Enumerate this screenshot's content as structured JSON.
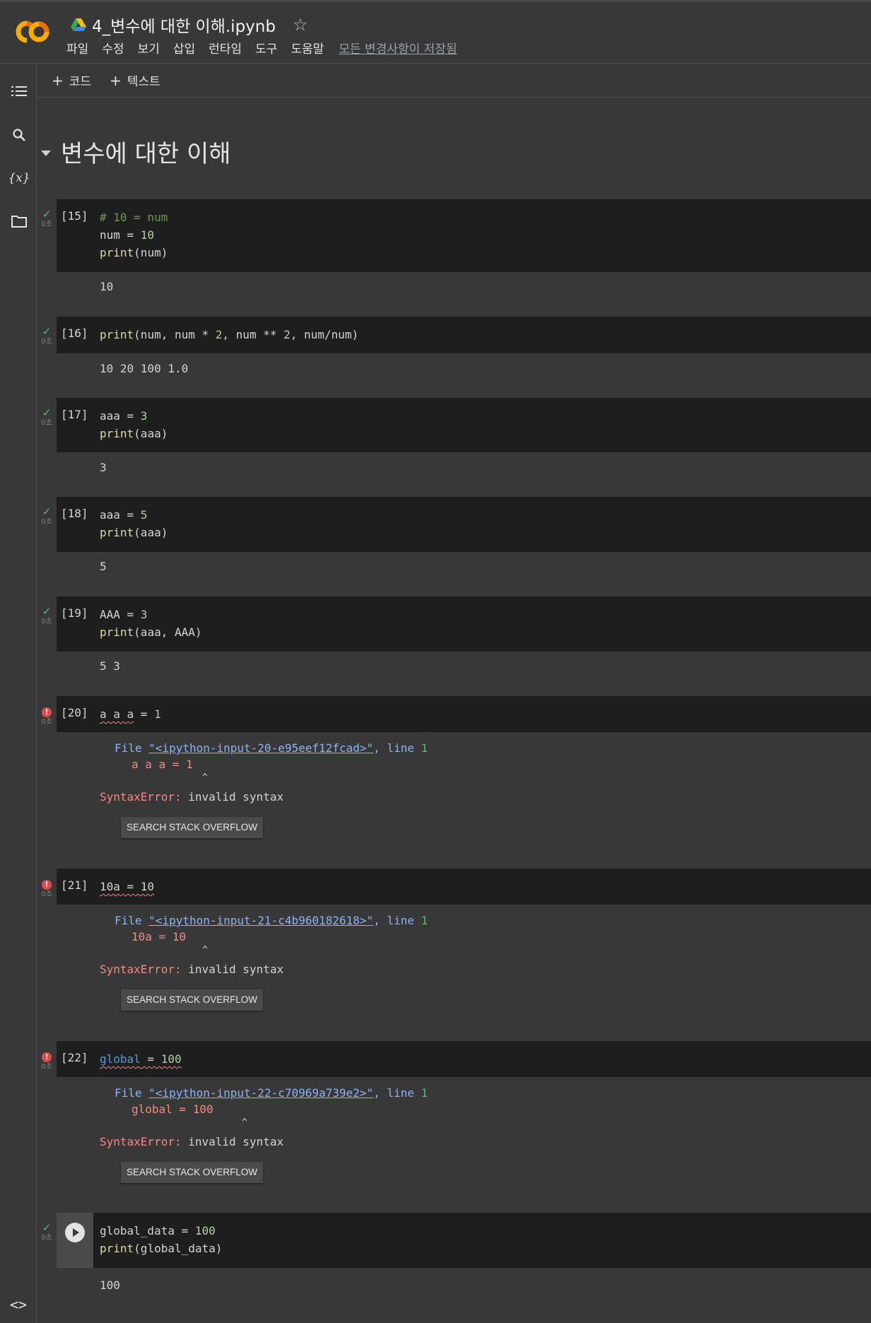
{
  "header": {
    "title": "4_변수에 대한 이해.ipynb",
    "menu": [
      "파일",
      "수정",
      "보기",
      "삽입",
      "런타임",
      "도구",
      "도움말"
    ],
    "save_status": "모든 변경사항이 저장됨"
  },
  "sidebar": {
    "icons": [
      "table-of-contents-icon",
      "search-icon",
      "variables-icon",
      "folder-icon"
    ],
    "variables_label": "{x}",
    "bottom_label": "<>"
  },
  "toolbar": {
    "add_code": "코드",
    "add_text": "텍스트"
  },
  "section": {
    "heading": "변수에 대한 이해"
  },
  "cells": {
    "c15": {
      "exec": "[15]",
      "time": "0초",
      "output": "10"
    },
    "c16": {
      "exec": "[16]",
      "time": "0초",
      "output": "10 20 100 1.0"
    },
    "c17": {
      "exec": "[17]",
      "time": "0초",
      "output": "3"
    },
    "c18": {
      "exec": "[18]",
      "time": "0초",
      "output": "5"
    },
    "c19": {
      "exec": "[19]",
      "time": "0초",
      "output": "5 3"
    },
    "c20": {
      "exec": "[20]",
      "time": "0초",
      "file": "\"<ipython-input-20-e95eef12fcad>\"",
      "err_line": "a a a = 1",
      "error_type": "SyntaxError:",
      "error_msg": " invalid syntax"
    },
    "c21": {
      "exec": "[21]",
      "time": "0초",
      "file": "\"<ipython-input-21-c4b960182618>\"",
      "err_line": "10a = 10",
      "error_type": "SyntaxError:",
      "error_msg": " invalid syntax"
    },
    "c22": {
      "exec": "[22]",
      "time": "0초",
      "file": "\"<ipython-input-22-c70969a739e2>\"",
      "err_line": "global = 100",
      "error_type": "SyntaxError:",
      "error_msg": " invalid syntax"
    },
    "c23": {
      "time": "0초",
      "output": "100"
    }
  },
  "traceback": {
    "file_label": "File ",
    "line_label": ", line ",
    "line_no": "1",
    "caret": "^"
  },
  "so_button": "SEARCH STACK OVERFLOW",
  "colors": {
    "background": "#383838",
    "code_bg": "#1e1e1e",
    "success": "#5bb974",
    "error": "#e24a4a",
    "link": "#8ab4f8"
  }
}
